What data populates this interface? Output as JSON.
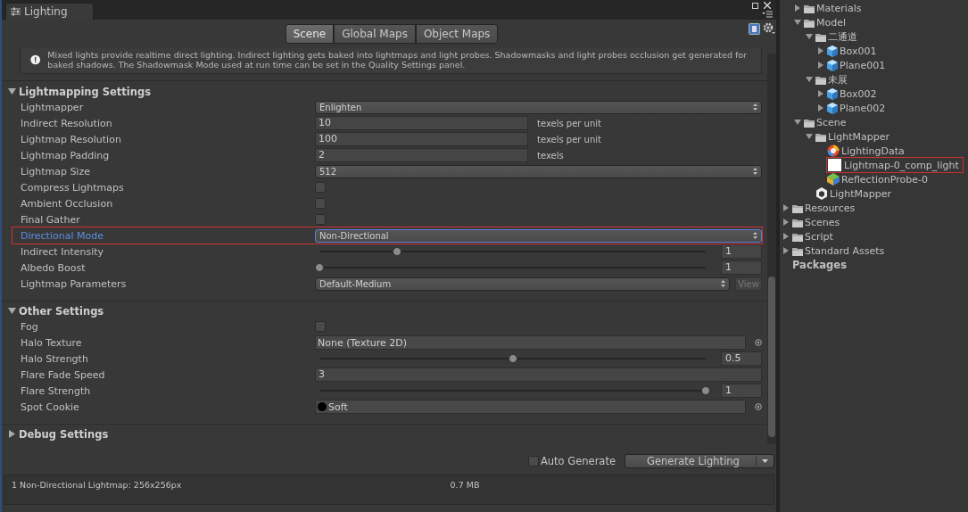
{
  "window": {
    "title": "Lighting"
  },
  "tabs": [
    {
      "label": "Scene",
      "selected": true
    },
    {
      "label": "Global Maps",
      "selected": false
    },
    {
      "label": "Object Maps",
      "selected": false
    }
  ],
  "info": {
    "text": "Mixed lights provide realtime direct lighting. Indirect lighting gets baked into lightmaps and light probes. Shadowmasks and light probes occlusion get generated for baked shadows. The Shadowmask Mode used at run time can be set in the Quality Settings panel."
  },
  "sections": [
    {
      "title": "Lightmapping Settings",
      "expanded": true,
      "rows": [
        {
          "kind": "dropdown",
          "label": "Lightmapper",
          "value": "Enlighten",
          "focused": false,
          "marked": false
        },
        {
          "kind": "number",
          "label": "Indirect Resolution",
          "value": "10",
          "unit": "texels per unit",
          "focused": false,
          "marked": false
        },
        {
          "kind": "number",
          "label": "Lightmap Resolution",
          "value": "100",
          "unit": "texels per unit",
          "focused": false,
          "marked": false
        },
        {
          "kind": "number",
          "label": "Lightmap Padding",
          "value": "2",
          "unit": "texels",
          "focused": false,
          "marked": false
        },
        {
          "kind": "dropdown",
          "label": "Lightmap Size",
          "value": "512",
          "focused": false,
          "marked": false
        },
        {
          "kind": "checkbox",
          "label": "Compress Lightmaps",
          "checked": false,
          "focused": false,
          "marked": false
        },
        {
          "kind": "checkbox",
          "label": "Ambient Occlusion",
          "checked": false,
          "focused": false,
          "marked": false
        },
        {
          "kind": "checkbox",
          "label": "Final Gather",
          "checked": false,
          "focused": false,
          "marked": false
        },
        {
          "kind": "dropdown",
          "label": "Directional Mode",
          "value": "Non-Directional",
          "focused": true,
          "marked": true
        },
        {
          "kind": "slider",
          "label": "Indirect Intensity",
          "level": 0.2,
          "reading": "1",
          "focused": false,
          "marked": false
        },
        {
          "kind": "slider",
          "label": "Albedo Boost",
          "level": 0,
          "reading": "1",
          "focused": false,
          "marked": false
        },
        {
          "kind": "dropdown-button",
          "label": "Lightmap Parameters",
          "value": "Default-Medium",
          "button": "View",
          "focused": false,
          "marked": false
        }
      ]
    },
    {
      "title": "Other Settings",
      "expanded": true,
      "rows": [
        {
          "kind": "checkbox",
          "label": "Fog",
          "checked": false,
          "focused": false,
          "marked": false
        },
        {
          "kind": "object",
          "label": "Halo Texture",
          "value": "None (Texture 2D)",
          "focused": false,
          "marked": false
        },
        {
          "kind": "slider",
          "label": "Halo Strength",
          "level": 0.5,
          "reading": "0.5",
          "focused": false,
          "marked": false
        },
        {
          "kind": "number",
          "label": "Flare Fade Speed",
          "value": "3",
          "focused": false,
          "marked": false
        },
        {
          "kind": "slider",
          "label": "Flare Strength",
          "level": 1,
          "reading": "1",
          "focused": false,
          "marked": false
        },
        {
          "kind": "object-dot",
          "label": "Spot Cookie",
          "value": "Soft",
          "focused": false,
          "marked": false
        }
      ]
    },
    {
      "title": "Debug Settings",
      "expanded": false
    }
  ],
  "auto_generate": {
    "label": "Auto Generate",
    "checked": false
  },
  "generate_button": {
    "label": "Generate Lighting"
  },
  "stats": {
    "summary": "1 Non-Directional Lightmap: 256x256px",
    "size": "0.7 MB"
  },
  "project_tree": [
    {
      "children": [
        {
          "label": "Materials",
          "kind": "folder",
          "expanded": false,
          "marked": false
        },
        {
          "label": "Model",
          "kind": "folder",
          "expanded": true,
          "marked": false,
          "children": [
            {
              "label": "二通道",
              "kind": "folder",
              "expanded": true,
              "marked": false,
              "children": [
                {
                  "label": "Box001",
                  "kind": "mesh",
                  "expanded": false,
                  "marked": false
                },
                {
                  "label": "Plane001",
                  "kind": "mesh",
                  "expanded": false,
                  "marked": false
                }
              ]
            },
            {
              "label": "未展",
              "kind": "folder",
              "expanded": true,
              "marked": false,
              "children": [
                {
                  "label": "Box002",
                  "kind": "mesh",
                  "expanded": false,
                  "marked": false
                },
                {
                  "label": "Plane002",
                  "kind": "mesh",
                  "expanded": false,
                  "marked": false
                }
              ]
            }
          ]
        },
        {
          "label": "Scene",
          "kind": "folder",
          "expanded": true,
          "marked": false,
          "children": [
            {
              "label": "LightMapper",
              "kind": "folder",
              "expanded": true,
              "marked": false,
              "children": [
                {
                  "label": "LightingData",
                  "kind": "lighting-data",
                  "marked": false
                },
                {
                  "label": "Lightmap-0_comp_light",
                  "kind": "texture",
                  "marked": true
                },
                {
                  "label": "ReflectionProbe-0",
                  "kind": "probe",
                  "marked": false
                }
              ]
            },
            {
              "label": "LightMapper",
              "kind": "scene",
              "marked": false
            }
          ]
        }
      ]
    },
    {
      "label": "Resources",
      "kind": "folder",
      "expanded": false,
      "marked": false
    },
    {
      "label": "Scenes",
      "kind": "folder",
      "expanded": false,
      "marked": false
    },
    {
      "label": "Script",
      "kind": "folder",
      "expanded": false,
      "marked": false
    },
    {
      "label": "Standard Assets",
      "kind": "folder",
      "expanded": false,
      "marked": false
    },
    {
      "label": "Packages",
      "kind": "root",
      "marked": false
    }
  ]
}
